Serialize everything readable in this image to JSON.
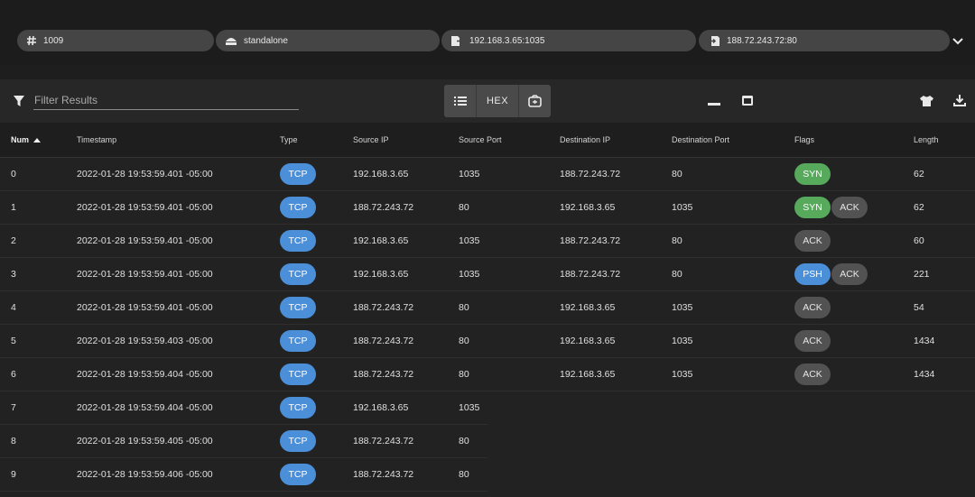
{
  "header": {
    "session_id": "1009",
    "mode": "standalone",
    "source": "192.168.3.65:1035",
    "destination": "188.72.243.72:80"
  },
  "toolbar": {
    "filter_placeholder": "Filter Results",
    "hex_label": "HEX"
  },
  "columns": {
    "num": "Num",
    "timestamp": "Timestamp",
    "type": "Type",
    "source_ip": "Source IP",
    "source_port": "Source Port",
    "destination_ip": "Destination IP",
    "destination_port": "Destination Port",
    "flags": "Flags",
    "length": "Length"
  },
  "rows": [
    {
      "num": "0",
      "timestamp": "2022-01-28 19:53:59.401 -05:00",
      "type": "TCP",
      "src_ip": "192.168.3.65",
      "src_port": "1035",
      "dst_ip": "188.72.243.72",
      "dst_port": "80",
      "flags": [
        "SYN"
      ],
      "length": "62"
    },
    {
      "num": "1",
      "timestamp": "2022-01-28 19:53:59.401 -05:00",
      "type": "TCP",
      "src_ip": "188.72.243.72",
      "src_port": "80",
      "dst_ip": "192.168.3.65",
      "dst_port": "1035",
      "flags": [
        "SYN",
        "ACK"
      ],
      "length": "62"
    },
    {
      "num": "2",
      "timestamp": "2022-01-28 19:53:59.401 -05:00",
      "type": "TCP",
      "src_ip": "192.168.3.65",
      "src_port": "1035",
      "dst_ip": "188.72.243.72",
      "dst_port": "80",
      "flags": [
        "ACK"
      ],
      "length": "60"
    },
    {
      "num": "3",
      "timestamp": "2022-01-28 19:53:59.401 -05:00",
      "type": "TCP",
      "src_ip": "192.168.3.65",
      "src_port": "1035",
      "dst_ip": "188.72.243.72",
      "dst_port": "80",
      "flags": [
        "PSH",
        "ACK"
      ],
      "length": "221"
    },
    {
      "num": "4",
      "timestamp": "2022-01-28 19:53:59.401 -05:00",
      "type": "TCP",
      "src_ip": "188.72.243.72",
      "src_port": "80",
      "dst_ip": "192.168.3.65",
      "dst_port": "1035",
      "flags": [
        "ACK"
      ],
      "length": "54"
    },
    {
      "num": "5",
      "timestamp": "2022-01-28 19:53:59.403 -05:00",
      "type": "TCP",
      "src_ip": "188.72.243.72",
      "src_port": "80",
      "dst_ip": "192.168.3.65",
      "dst_port": "1035",
      "flags": [
        "ACK"
      ],
      "length": "1434"
    },
    {
      "num": "6",
      "timestamp": "2022-01-28 19:53:59.404 -05:00",
      "type": "TCP",
      "src_ip": "188.72.243.72",
      "src_port": "80",
      "dst_ip": "192.168.3.65",
      "dst_port": "1035",
      "flags": [
        "ACK"
      ],
      "length": "1434"
    },
    {
      "num": "7",
      "timestamp": "2022-01-28 19:53:59.404 -05:00",
      "type": "TCP",
      "src_ip": "192.168.3.65",
      "src_port": "1035",
      "dst_ip": "",
      "dst_port": "",
      "flags": [],
      "length": ""
    },
    {
      "num": "8",
      "timestamp": "2022-01-28 19:53:59.405 -05:00",
      "type": "TCP",
      "src_ip": "188.72.243.72",
      "src_port": "80",
      "dst_ip": "",
      "dst_port": "",
      "flags": [],
      "length": ""
    },
    {
      "num": "9",
      "timestamp": "2022-01-28 19:53:59.406 -05:00",
      "type": "TCP",
      "src_ip": "188.72.243.72",
      "src_port": "80",
      "dst_ip": "",
      "dst_port": "",
      "flags": [],
      "length": ""
    }
  ],
  "colors": {
    "tcp_badge": "#4b8fd9",
    "syn_flag": "#57a95c",
    "ack_flag": "#525252",
    "psh_flag": "#4b8fd9"
  }
}
